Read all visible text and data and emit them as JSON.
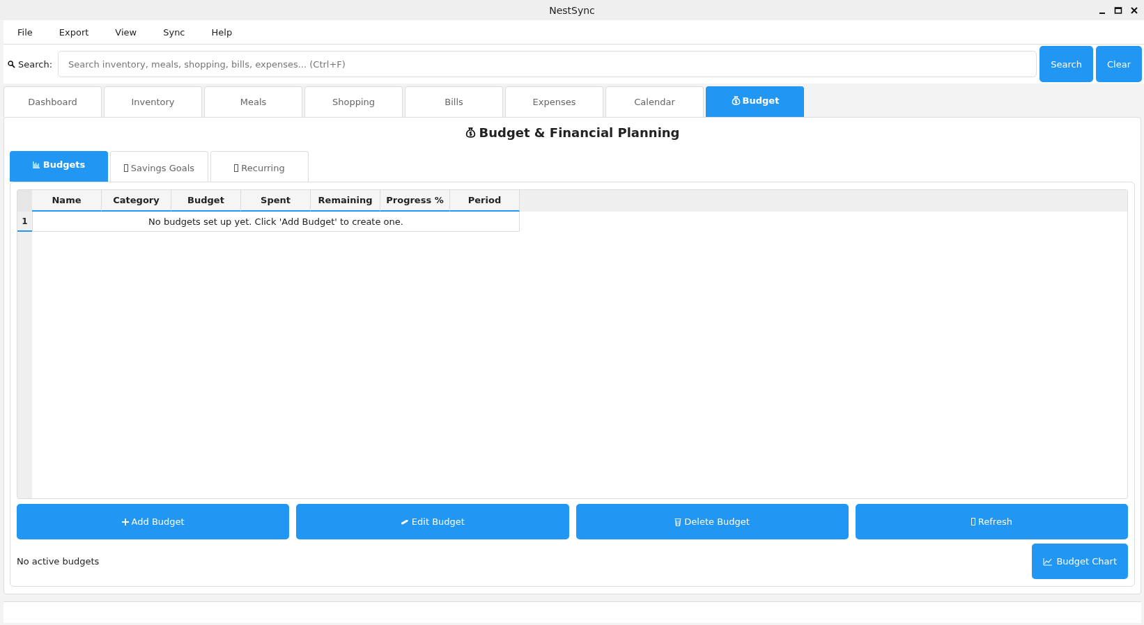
{
  "window": {
    "title": "NestSync"
  },
  "menu": [
    "File",
    "Export",
    "View",
    "Sync",
    "Help"
  ],
  "search": {
    "label": "Search:",
    "placeholder": "Search inventory, meals, shopping, bills, expenses... (Ctrl+F)",
    "buttons": [
      "Search",
      "Clear"
    ]
  },
  "tabs": [
    {
      "label": "Dashboard",
      "selected": false
    },
    {
      "label": "Inventory",
      "selected": false
    },
    {
      "label": "Meals",
      "selected": false
    },
    {
      "label": "Shopping",
      "selected": false
    },
    {
      "label": "Bills",
      "selected": false
    },
    {
      "label": "Expenses",
      "selected": false
    },
    {
      "label": "Calendar",
      "selected": false
    },
    {
      "label": "Budget",
      "selected": true,
      "kind": "money-bag"
    }
  ],
  "heading": "Budget & Financial Planning",
  "subtabs": [
    {
      "label": "Budgets",
      "selected": true,
      "kind": "bar-chart"
    },
    {
      "label": "Savings Goals",
      "selected": false,
      "kind": "missing-glyph"
    },
    {
      "label": "Recurring",
      "selected": false,
      "kind": "missing-glyph"
    }
  ],
  "table": {
    "columns": [
      "Name",
      "Category",
      "Budget",
      "Spent",
      "Remaining",
      "Progress %",
      "Period"
    ],
    "rows": [
      {
        "number": "1",
        "message": "No budgets set up yet. Click 'Add Budget' to create one."
      }
    ]
  },
  "actions": [
    {
      "label": "Add Budget",
      "kind": "plus"
    },
    {
      "label": "Edit Budget",
      "kind": "pencil"
    },
    {
      "label": "Delete Budget",
      "kind": "trash"
    },
    {
      "label": "Refresh",
      "kind": "missing-glyph"
    }
  ],
  "status": "No active budgets",
  "chart_button": {
    "label": "Budget Chart",
    "kind": "line-chart"
  }
}
